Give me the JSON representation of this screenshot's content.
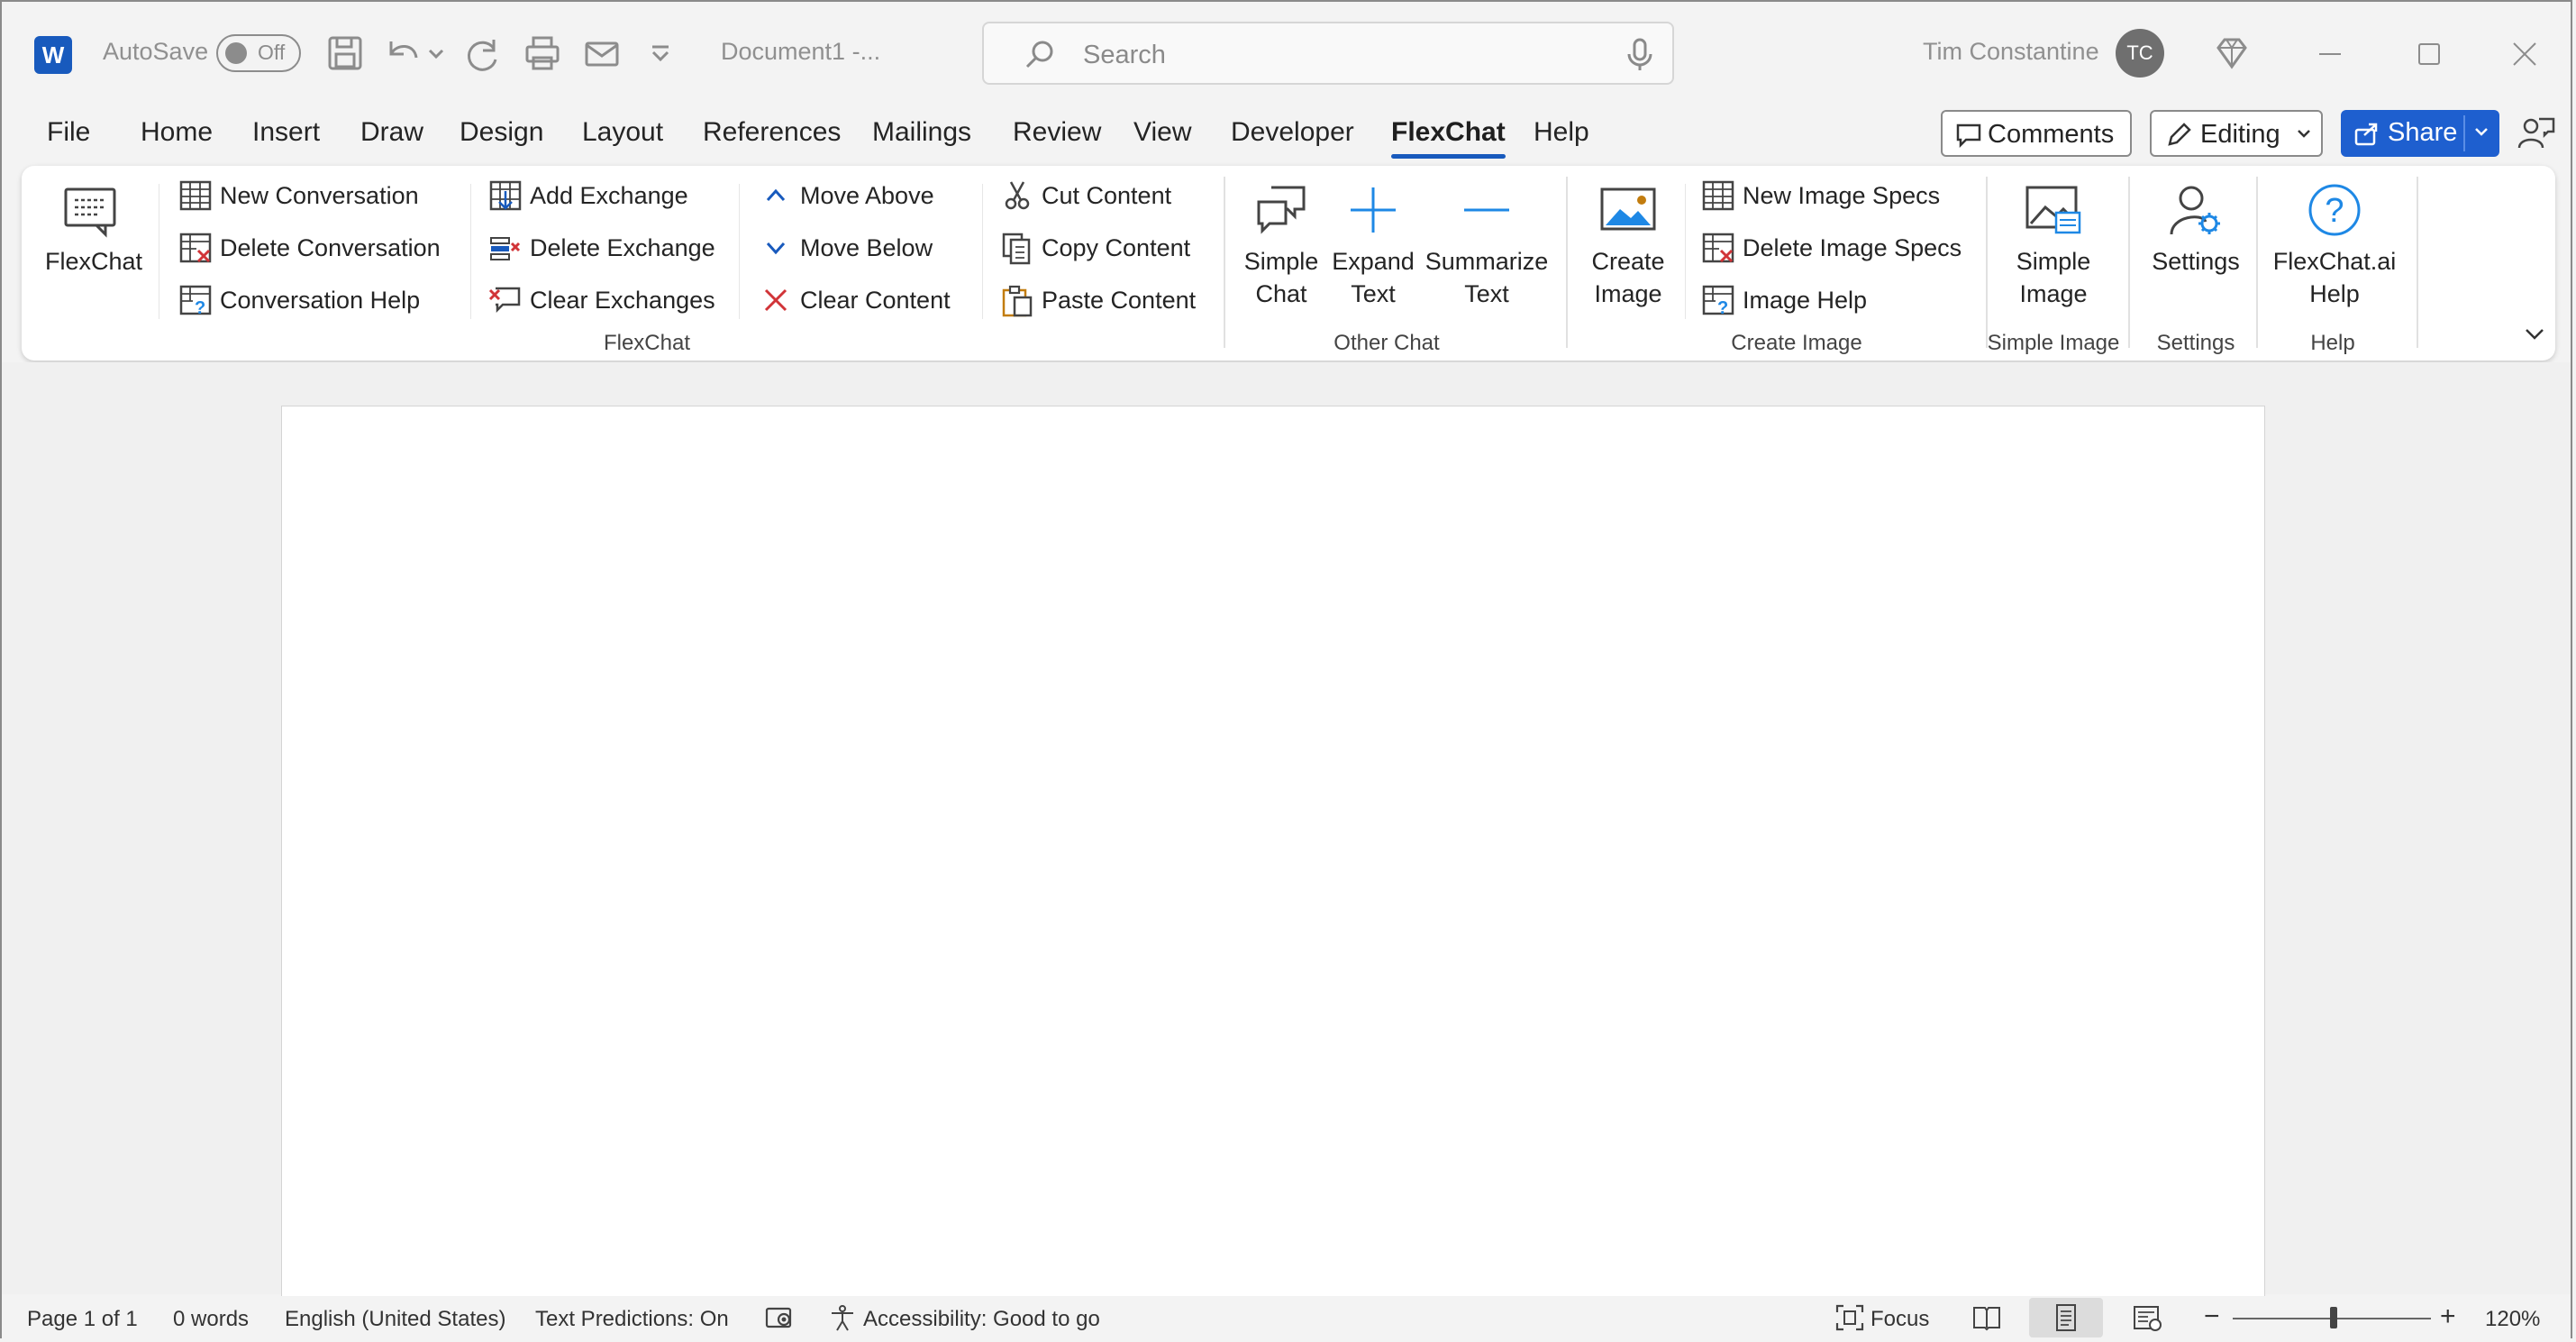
{
  "titlebar": {
    "autosave_label": "AutoSave",
    "autosave_state": "Off",
    "doc_title": "Document1  -...",
    "search_placeholder": "Search",
    "user_name": "Tim Constantine",
    "user_initials": "TC"
  },
  "tabs": [
    "File",
    "Home",
    "Insert",
    "Draw",
    "Design",
    "Layout",
    "References",
    "Mailings",
    "Review",
    "View",
    "Developer",
    "FlexChat",
    "Help"
  ],
  "active_tab": "FlexChat",
  "header_buttons": {
    "comments": "Comments",
    "editing": "Editing",
    "share": "Share"
  },
  "ribbon": {
    "flexchat_large": "FlexChat",
    "conversation": [
      "New Conversation",
      "Delete Conversation",
      "Conversation Help"
    ],
    "exchange": [
      "Add Exchange",
      "Delete Exchange",
      "Clear Exchanges"
    ],
    "move": [
      "Move Above",
      "Move Below",
      "Clear Content"
    ],
    "clipboard": [
      "Cut Content",
      "Copy Content",
      "Paste Content"
    ],
    "group_flexchat": "FlexChat",
    "simple_chat": [
      "Simple",
      "Chat"
    ],
    "expand_text": [
      "Expand",
      "Text"
    ],
    "summarize_text": [
      "Summarize",
      "Text"
    ],
    "group_other_chat": "Other Chat",
    "create_image": [
      "Create",
      "Image"
    ],
    "image_specs": [
      "New Image Specs",
      "Delete Image Specs",
      "Image Help"
    ],
    "group_create_image": "Create Image",
    "simple_image": [
      "Simple",
      "Image"
    ],
    "group_simple_image": "Simple Image",
    "settings": "Settings",
    "group_settings": "Settings",
    "flexchat_help": [
      "FlexChat.ai",
      "Help"
    ],
    "group_help": "Help"
  },
  "status": {
    "page": "Page 1 of 1",
    "words": "0 words",
    "language": "English (United States)",
    "predictions": "Text Predictions: On",
    "accessibility": "Accessibility: Good to go",
    "focus": "Focus",
    "zoom": "120%",
    "zoom_minus": "−",
    "zoom_plus": "+"
  },
  "colors": {
    "accent": "#185abd",
    "share": "#1e5fcf",
    "delete_red": "#d13438",
    "help_blue": "#1e88e5"
  }
}
